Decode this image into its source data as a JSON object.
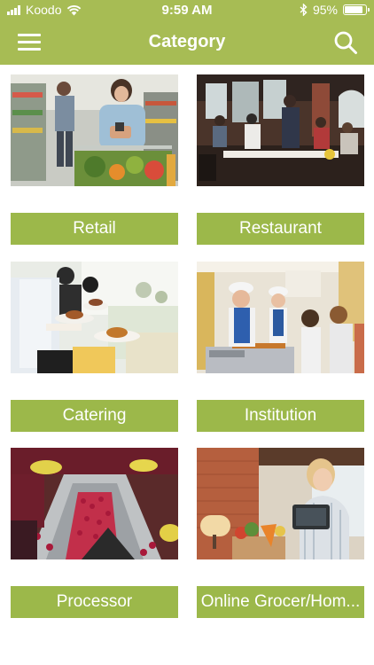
{
  "status_bar": {
    "carrier": "Koodo",
    "time": "9:59 AM",
    "battery": "95%",
    "battery_level": 0.95
  },
  "header": {
    "title": "Category",
    "menu_icon": "hamburger-menu-icon",
    "search_icon": "search-icon"
  },
  "colors": {
    "header_bg": "#a7bc54",
    "label_bg": "#9cb84a",
    "label_text": "#ffffff"
  },
  "categories": [
    {
      "label": "Retail",
      "image": "retail-grocery-photo"
    },
    {
      "label": "Restaurant",
      "image": "restaurant-diners-photo"
    },
    {
      "label": "Catering",
      "image": "catering-service-photo"
    },
    {
      "label": "Institution",
      "image": "cafeteria-serving-photo"
    },
    {
      "label": "Processor",
      "image": "berry-processing-line-photo"
    },
    {
      "label": "Online Grocer/Hom...",
      "image": "online-grocer-tablet-photo"
    }
  ]
}
